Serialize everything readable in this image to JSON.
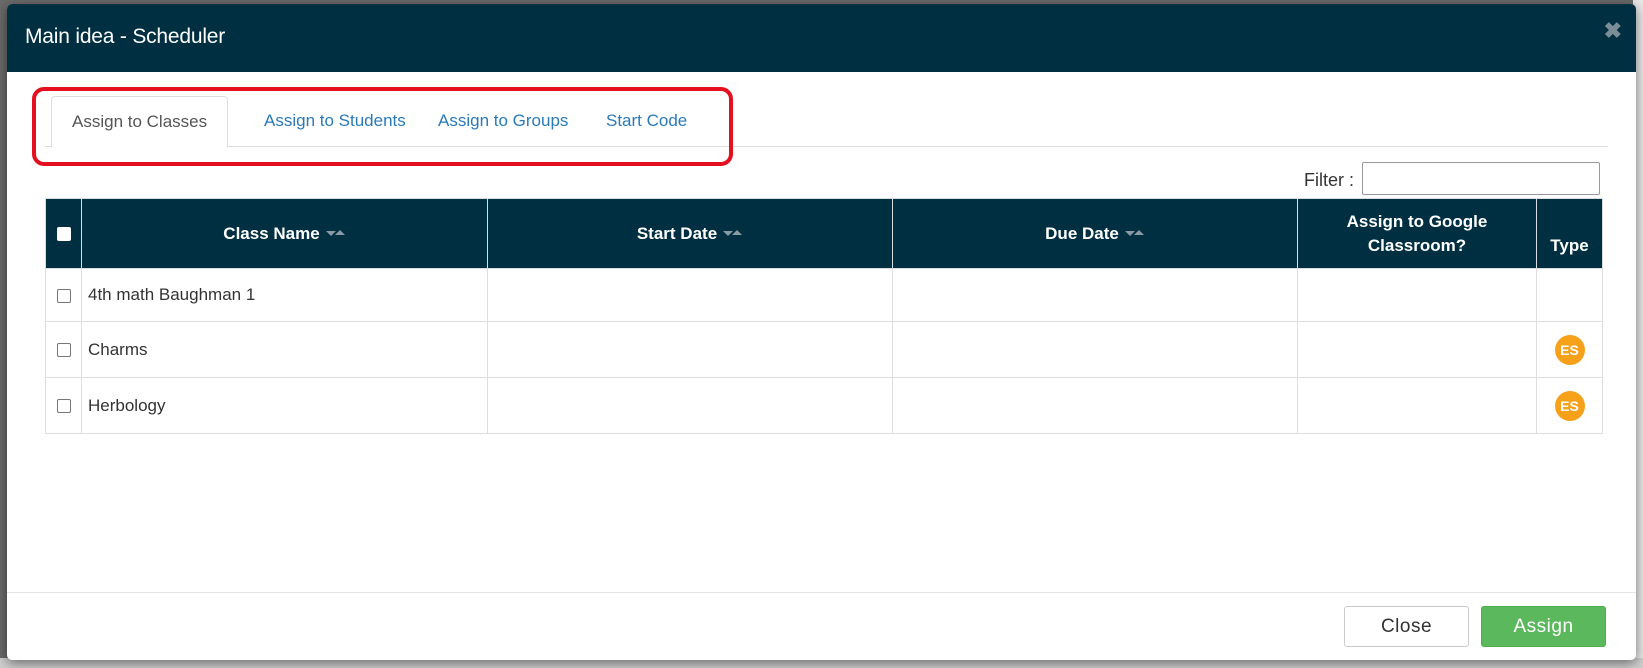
{
  "modal": {
    "title": "Main idea - Scheduler",
    "close_icon": "close-icon",
    "tabs": [
      {
        "label": "Assign to Classes",
        "active": true
      },
      {
        "label": "Assign to Students",
        "active": false
      },
      {
        "label": "Assign to Groups",
        "active": false
      },
      {
        "label": "Start Code",
        "active": false
      }
    ],
    "filter": {
      "label": "Filter :",
      "value": ""
    },
    "table": {
      "columns": [
        {
          "label": "",
          "type": "checkbox"
        },
        {
          "label": "Class Name",
          "sortable": true
        },
        {
          "label": "Start Date",
          "sortable": true
        },
        {
          "label": "Due Date",
          "sortable": true
        },
        {
          "label": "Assign to Google Classroom?",
          "sortable": false
        },
        {
          "label": "Type",
          "sortable": false
        }
      ],
      "rows": [
        {
          "checked": false,
          "class_name": "4th math Baughman 1",
          "start_date": "",
          "due_date": "",
          "google_classroom": "",
          "type": ""
        },
        {
          "checked": false,
          "class_name": "Charms",
          "start_date": "",
          "due_date": "",
          "google_classroom": "",
          "type": "ES"
        },
        {
          "checked": false,
          "class_name": "Herbology",
          "start_date": "",
          "due_date": "",
          "google_classroom": "",
          "type": "ES"
        }
      ]
    },
    "buttons": {
      "close_label": "Close",
      "assign_label": "Assign"
    }
  },
  "colors": {
    "header_bg": "#002f42",
    "tab_link": "#2a7ab8",
    "highlight": "#e4101f",
    "badge": "#f7a11a",
    "assign_button": "#5cb85c"
  }
}
